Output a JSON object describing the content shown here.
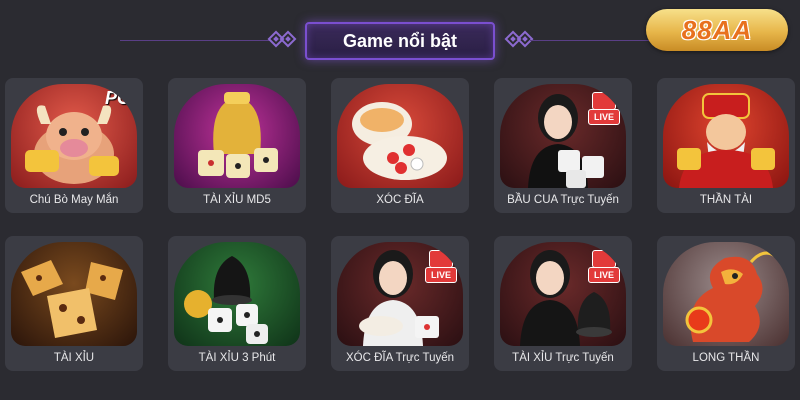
{
  "header": {
    "title": "Game nổi bật"
  },
  "logo": {
    "text": "88AA"
  },
  "games": [
    {
      "label": "Chú Bò May Mắn",
      "theme": "ox-pg"
    },
    {
      "label": "TÀI XỈU MD5",
      "theme": "golden-dice-cup"
    },
    {
      "label": "XÓC ĐĨA",
      "theme": "bowl-plate"
    },
    {
      "label": "BẦU CUA Trực Tuyến",
      "theme": "live-dealer-dice",
      "badge": "LIVE"
    },
    {
      "label": "THẦN TÀI",
      "theme": "wealth-god"
    },
    {
      "label": "TÀI XỈU",
      "theme": "golden-dice"
    },
    {
      "label": "TÀI XỈU 3 Phút",
      "theme": "black-cup-dice"
    },
    {
      "label": "XÓC ĐĨA Trực Tuyến",
      "theme": "live-dealer-plate",
      "badge": "LIVE"
    },
    {
      "label": "TÀI XỈU Trực Tuyến",
      "theme": "live-dealer-cup",
      "badge": "LIVE"
    },
    {
      "label": "LONG THẦN",
      "theme": "dragon"
    }
  ],
  "badges": {
    "pg": "PG"
  }
}
